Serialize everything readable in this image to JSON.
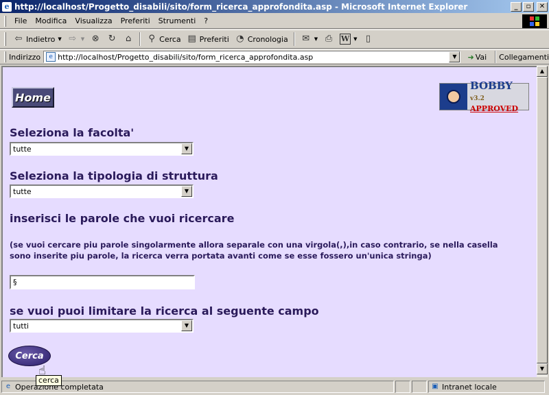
{
  "window": {
    "title": "http://localhost/Progetto_disabili/sito/form_ricerca_approfondita.asp - Microsoft Internet Explorer",
    "minimize": "_",
    "maximize": "▫",
    "close": "✕"
  },
  "menu": {
    "items": [
      {
        "label": "File"
      },
      {
        "label": "Modifica"
      },
      {
        "label": "Visualizza"
      },
      {
        "label": "Preferiti"
      },
      {
        "label": "Strumenti"
      },
      {
        "label": "?"
      }
    ]
  },
  "toolbar": {
    "back_label": "Indietro",
    "search_label": "Cerca",
    "favorites_label": "Preferiti",
    "history_label": "Cronologia"
  },
  "address": {
    "label": "Indirizzo",
    "url": "http://localhost/Progetto_disabili/sito/form_ricerca_approfondita.asp",
    "go_label": "Vai",
    "links_label": "Collegamenti"
  },
  "page": {
    "home_label": "Home",
    "bobby": {
      "name": "BOBBY",
      "version": "v3.2",
      "status": "APPROVED"
    },
    "faculty_label": "Seleziona la facolta'",
    "faculty_value": "tutte",
    "structure_label": "Seleziona la tipologia di struttura",
    "structure_value": "tutte",
    "keywords_label": "inserisci le parole che vuoi ricercare",
    "keywords_note": "(se vuoi cercare piu parole singolarmente allora separale con una virgola(,),in caso contrario, se nella casella sono inserite piu parole, la ricerca verra portata avanti come se esse fossero un'unica stringa)",
    "keywords_value": "§",
    "field_label": "se vuoi puoi limitare la ricerca al seguente campo",
    "field_value": "tutti",
    "search_button": "Cerca",
    "tooltip": "cerca"
  },
  "status": {
    "text": "Operazione completata",
    "zone": "Intranet locale"
  }
}
